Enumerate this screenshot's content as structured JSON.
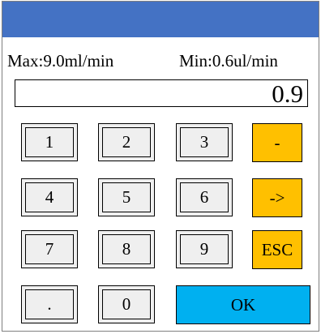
{
  "limits": {
    "max_label": "Max:9.0ml/min",
    "min_label": "Min:0.6ul/min"
  },
  "display": {
    "value": "0.9"
  },
  "keypad": {
    "k1": "1",
    "k2": "2",
    "k3": "3",
    "minus": "-",
    "k4": "4",
    "k5": "5",
    "k6": "6",
    "arrow": "->",
    "k7": "7",
    "k8": "8",
    "k9": "9",
    "esc": "ESC",
    "dot": ".",
    "k0": "0",
    "ok": "OK"
  },
  "colors": {
    "title_bar": "#4472c4",
    "key_face": "#efefef",
    "function_key": "#ffc000",
    "ok_key": "#00b0f0"
  }
}
